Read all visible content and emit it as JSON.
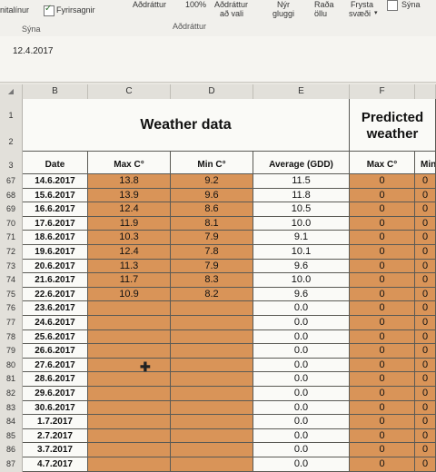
{
  "ribbon": {
    "items": [
      "nitalínur",
      "Fyrirsagnir",
      "Aðdráttur",
      "100%",
      "Aðdráttur",
      "að vali",
      "Nýr",
      "gluggi",
      "Raða",
      "öllu",
      "Frysta",
      "svæði",
      "Sýna"
    ],
    "group_labels": [
      "Sýna",
      "Aðdráttur"
    ]
  },
  "formula_bar": {
    "value": "12.4.2017"
  },
  "columns": [
    "B",
    "C",
    "D",
    "E",
    "F"
  ],
  "header_rows": [
    "1",
    "2",
    "3"
  ],
  "sheet": {
    "title": "Weather data",
    "title2_line1": "Predicted",
    "title2_line2": "weather",
    "col_labels": [
      "Date",
      "Max C°",
      "Min C°",
      "Average (GDD)",
      "Max C°",
      "Min"
    ]
  },
  "rows": [
    {
      "n": "67",
      "date": "14.6.2017",
      "max": "13.8",
      "min": "9.2",
      "avg": "11.5",
      "pmax": "0",
      "pmin": "0"
    },
    {
      "n": "68",
      "date": "15.6.2017",
      "max": "13.9",
      "min": "9.6",
      "avg": "11.8",
      "pmax": "0",
      "pmin": "0"
    },
    {
      "n": "69",
      "date": "16.6.2017",
      "max": "12.4",
      "min": "8.6",
      "avg": "10.5",
      "pmax": "0",
      "pmin": "0"
    },
    {
      "n": "70",
      "date": "17.6.2017",
      "max": "11.9",
      "min": "8.1",
      "avg": "10.0",
      "pmax": "0",
      "pmin": "0"
    },
    {
      "n": "71",
      "date": "18.6.2017",
      "max": "10.3",
      "min": "7.9",
      "avg": "9.1",
      "pmax": "0",
      "pmin": "0"
    },
    {
      "n": "72",
      "date": "19.6.2017",
      "max": "12.4",
      "min": "7.8",
      "avg": "10.1",
      "pmax": "0",
      "pmin": "0"
    },
    {
      "n": "73",
      "date": "20.6.2017",
      "max": "11.3",
      "min": "7.9",
      "avg": "9.6",
      "pmax": "0",
      "pmin": "0"
    },
    {
      "n": "74",
      "date": "21.6.2017",
      "max": "11.7",
      "min": "8.3",
      "avg": "10.0",
      "pmax": "0",
      "pmin": "0"
    },
    {
      "n": "75",
      "date": "22.6.2017",
      "max": "10.9",
      "min": "8.2",
      "avg": "9.6",
      "pmax": "0",
      "pmin": "0"
    },
    {
      "n": "76",
      "date": "23.6.2017",
      "max": "",
      "min": "",
      "avg": "0.0",
      "pmax": "0",
      "pmin": "0"
    },
    {
      "n": "77",
      "date": "24.6.2017",
      "max": "",
      "min": "",
      "avg": "0.0",
      "pmax": "0",
      "pmin": "0"
    },
    {
      "n": "78",
      "date": "25.6.2017",
      "max": "",
      "min": "",
      "avg": "0.0",
      "pmax": "0",
      "pmin": "0"
    },
    {
      "n": "79",
      "date": "26.6.2017",
      "max": "",
      "min": "",
      "avg": "0.0",
      "pmax": "0",
      "pmin": "0"
    },
    {
      "n": "80",
      "date": "27.6.2017",
      "max": "",
      "min": "",
      "avg": "0.0",
      "pmax": "0",
      "pmin": "0"
    },
    {
      "n": "81",
      "date": "28.6.2017",
      "max": "",
      "min": "",
      "avg": "0.0",
      "pmax": "0",
      "pmin": "0"
    },
    {
      "n": "82",
      "date": "29.6.2017",
      "max": "",
      "min": "",
      "avg": "0.0",
      "pmax": "0",
      "pmin": "0"
    },
    {
      "n": "83",
      "date": "30.6.2017",
      "max": "",
      "min": "",
      "avg": "0.0",
      "pmax": "0",
      "pmin": "0"
    },
    {
      "n": "84",
      "date": "1.7.2017",
      "max": "",
      "min": "",
      "avg": "0.0",
      "pmax": "0",
      "pmin": "0"
    },
    {
      "n": "85",
      "date": "2.7.2017",
      "max": "",
      "min": "",
      "avg": "0.0",
      "pmax": "0",
      "pmin": "0"
    },
    {
      "n": "86",
      "date": "3.7.2017",
      "max": "",
      "min": "",
      "avg": "0.0",
      "pmax": "0",
      "pmin": "0"
    },
    {
      "n": "87",
      "date": "4.7.2017",
      "max": "",
      "min": "",
      "avg": "0.0",
      "pmax": "0",
      "pmin": "0"
    }
  ],
  "colors": {
    "input_fill": "#d99458",
    "white_fill": "#fafaf7"
  }
}
